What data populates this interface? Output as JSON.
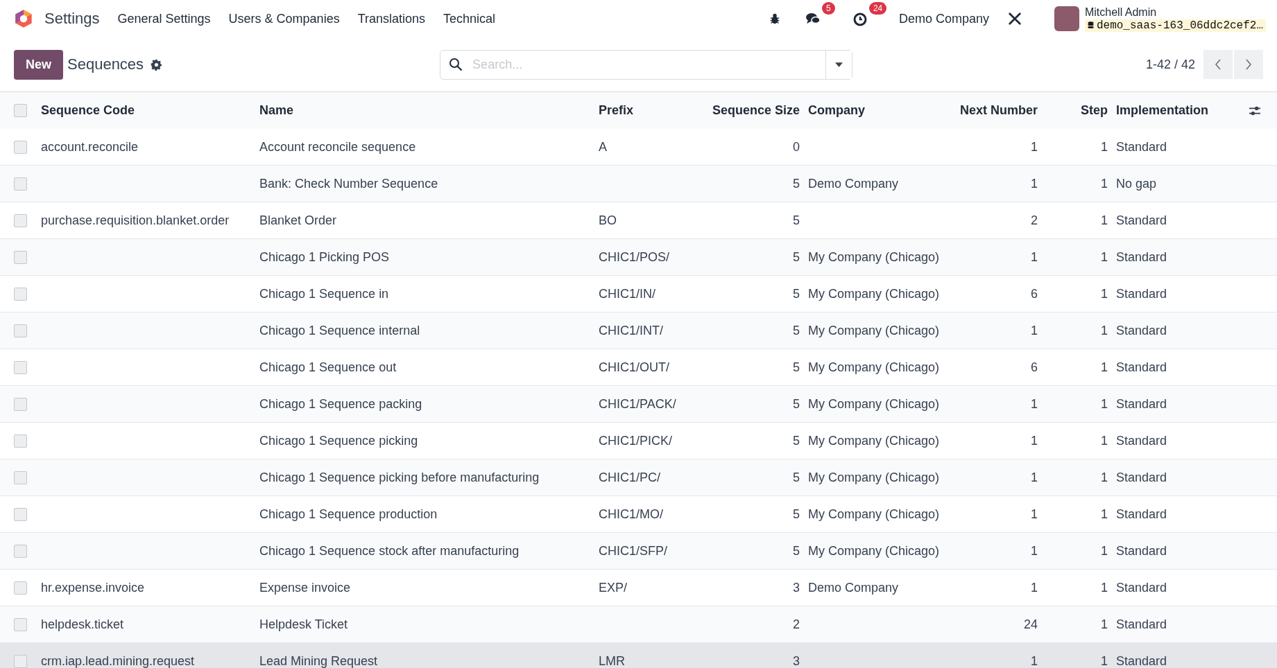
{
  "navbar": {
    "app_name": "Settings",
    "menu": [
      "General Settings",
      "Users & Companies",
      "Translations",
      "Technical"
    ],
    "messages_badge": "5",
    "activities_badge": "24",
    "company": "Demo Company",
    "user_name": "Mitchell Admin",
    "database": "demo_saas-163_06ddc2cef2…"
  },
  "control_panel": {
    "new_button": "New",
    "title": "Sequences",
    "search": {
      "placeholder": "Search..."
    },
    "pager": "1-42 / 42"
  },
  "table": {
    "all_selected": false,
    "columns": [
      "Sequence Code",
      "Name",
      "Prefix",
      "Sequence Size",
      "Company",
      "Next Number",
      "Step",
      "Implementation"
    ],
    "rows": [
      {
        "code": "account.reconcile",
        "name": "Account reconcile sequence",
        "prefix": "A",
        "size": "0",
        "company": "",
        "next": "1",
        "step": "1",
        "implementation": "Standard",
        "checked": false,
        "hovered": false
      },
      {
        "code": "",
        "name": "Bank: Check Number Sequence",
        "prefix": "",
        "size": "5",
        "company": "Demo Company",
        "next": "1",
        "step": "1",
        "implementation": "No gap",
        "checked": false,
        "hovered": false
      },
      {
        "code": "purchase.requisition.blanket.order",
        "name": "Blanket Order",
        "prefix": "BO",
        "size": "5",
        "company": "",
        "next": "2",
        "step": "1",
        "implementation": "Standard",
        "checked": false,
        "hovered": false
      },
      {
        "code": "",
        "name": "Chicago 1 Picking POS",
        "prefix": "CHIC1/POS/",
        "size": "5",
        "company": "My Company (Chicago)",
        "next": "1",
        "step": "1",
        "implementation": "Standard",
        "checked": false,
        "hovered": false
      },
      {
        "code": "",
        "name": "Chicago 1 Sequence in",
        "prefix": "CHIC1/IN/",
        "size": "5",
        "company": "My Company (Chicago)",
        "next": "6",
        "step": "1",
        "implementation": "Standard",
        "checked": false,
        "hovered": false
      },
      {
        "code": "",
        "name": "Chicago 1 Sequence internal",
        "prefix": "CHIC1/INT/",
        "size": "5",
        "company": "My Company (Chicago)",
        "next": "1",
        "step": "1",
        "implementation": "Standard",
        "checked": false,
        "hovered": false
      },
      {
        "code": "",
        "name": "Chicago 1 Sequence out",
        "prefix": "CHIC1/OUT/",
        "size": "5",
        "company": "My Company (Chicago)",
        "next": "6",
        "step": "1",
        "implementation": "Standard",
        "checked": false,
        "hovered": false
      },
      {
        "code": "",
        "name": "Chicago 1 Sequence packing",
        "prefix": "CHIC1/PACK/",
        "size": "5",
        "company": "My Company (Chicago)",
        "next": "1",
        "step": "1",
        "implementation": "Standard",
        "checked": false,
        "hovered": false
      },
      {
        "code": "",
        "name": "Chicago 1 Sequence picking",
        "prefix": "CHIC1/PICK/",
        "size": "5",
        "company": "My Company (Chicago)",
        "next": "1",
        "step": "1",
        "implementation": "Standard",
        "checked": false,
        "hovered": false
      },
      {
        "code": "",
        "name": "Chicago 1 Sequence picking before manufacturing",
        "prefix": "CHIC1/PC/",
        "size": "5",
        "company": "My Company (Chicago)",
        "next": "1",
        "step": "1",
        "implementation": "Standard",
        "checked": false,
        "hovered": false
      },
      {
        "code": "",
        "name": "Chicago 1 Sequence production",
        "prefix": "CHIC1/MO/",
        "size": "5",
        "company": "My Company (Chicago)",
        "next": "1",
        "step": "1",
        "implementation": "Standard",
        "checked": false,
        "hovered": false
      },
      {
        "code": "",
        "name": "Chicago 1 Sequence stock after manufacturing",
        "prefix": "CHIC1/SFP/",
        "size": "5",
        "company": "My Company (Chicago)",
        "next": "1",
        "step": "1",
        "implementation": "Standard",
        "checked": false,
        "hovered": false
      },
      {
        "code": "hr.expense.invoice",
        "name": "Expense invoice",
        "prefix": "EXP/",
        "size": "3",
        "company": "Demo Company",
        "next": "1",
        "step": "1",
        "implementation": "Standard",
        "checked": false,
        "hovered": false
      },
      {
        "code": "helpdesk.ticket",
        "name": "Helpdesk Ticket",
        "prefix": "",
        "size": "2",
        "company": "",
        "next": "24",
        "step": "1",
        "implementation": "Standard",
        "checked": false,
        "hovered": false
      },
      {
        "code": "crm.iap.lead.mining.request",
        "name": "Lead Mining Request",
        "prefix": "LMR",
        "size": "3",
        "company": "",
        "next": "1",
        "step": "1",
        "implementation": "Standard",
        "checked": false,
        "hovered": true
      }
    ]
  }
}
